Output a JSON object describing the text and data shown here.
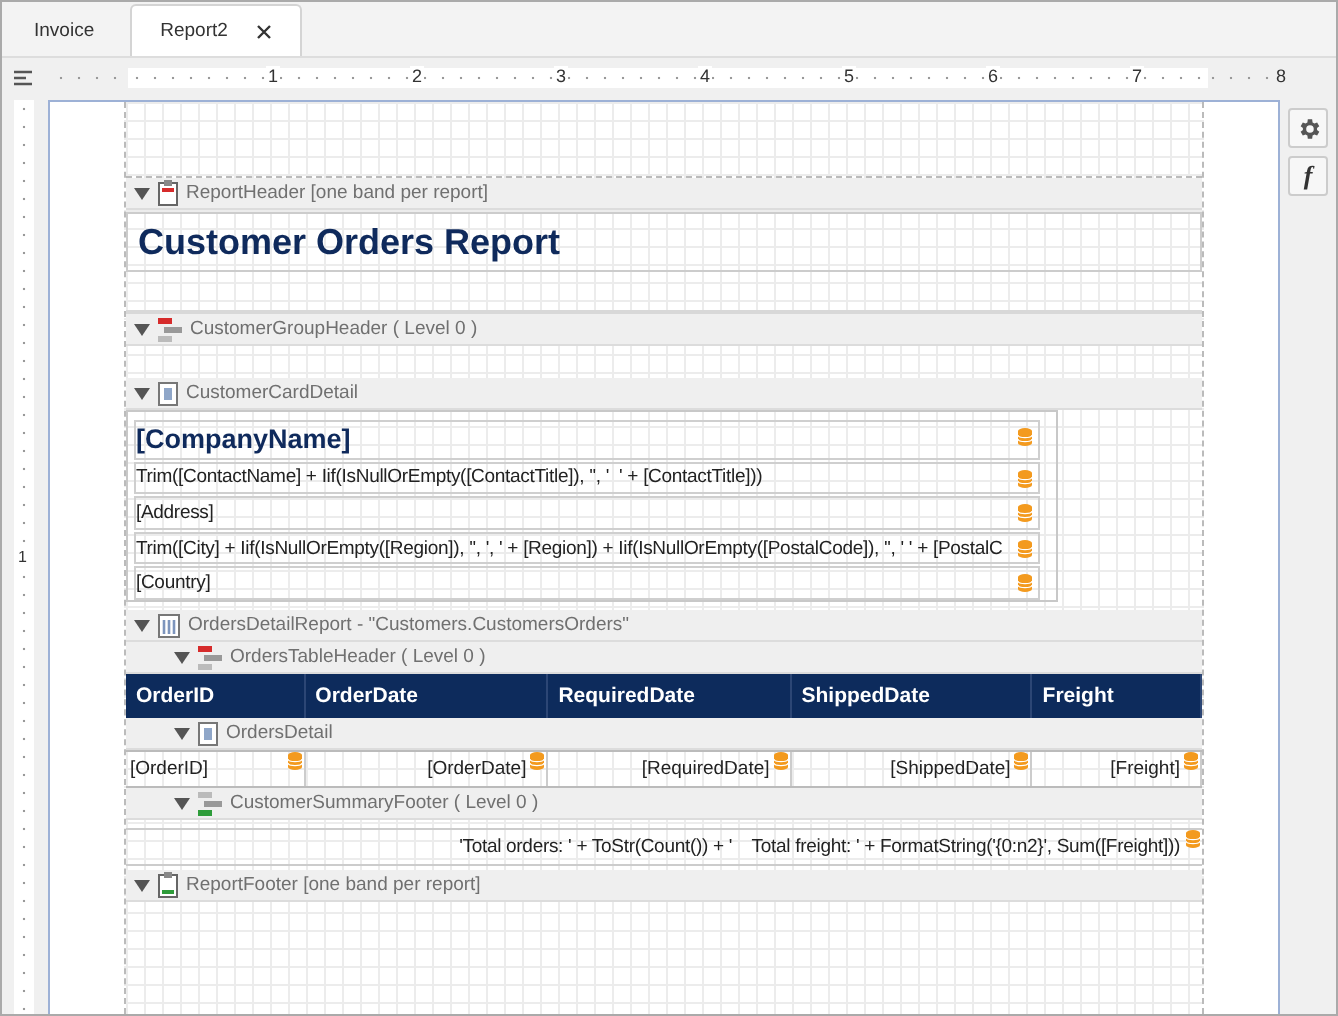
{
  "tabs": [
    {
      "label": "Invoice",
      "selected": false
    },
    {
      "label": "Report2",
      "selected": true
    }
  ],
  "ruler": {
    "marks": [
      "1",
      "2",
      "3",
      "4",
      "5",
      "6",
      "7",
      "8"
    ],
    "vertical_marks": [
      "1"
    ]
  },
  "side_buttons": [
    {
      "kind": "settings"
    },
    {
      "kind": "function",
      "glyph": "f"
    }
  ],
  "sections": [
    {
      "label": "ReportHeader [one band per report]",
      "kind": "report-header",
      "expanded": true,
      "content": {
        "kind": "title",
        "text": "Customer Orders Report"
      }
    },
    {
      "label": "CustomerGroupHeader ( Level 0 )",
      "kind": "group-header",
      "expanded": true
    },
    {
      "label": "CustomerCardDetail",
      "kind": "detail",
      "expanded": true,
      "content": {
        "kind": "card",
        "fields": [
          {
            "kind": "heading",
            "text": "[CompanyName]"
          },
          {
            "kind": "plain",
            "text": "Trim([ContactName] + Iif(IsNullOrEmpty([ContactTitle]), '', '  ' + [ContactTitle]))"
          },
          {
            "kind": "plain",
            "text": "[Address]"
          },
          {
            "kind": "plain",
            "text": "Trim([City] + Iif(IsNullOrEmpty([Region]), '', ', ' + [Region]) + Iif(IsNullOrEmpty([PostalCode]), '', ' ' + [PostalC"
          },
          {
            "kind": "plain",
            "text": "[Country]"
          }
        ]
      }
    },
    {
      "label": "OrdersDetailReport - \"Customers.CustomersOrders\"",
      "kind": "detail-report",
      "expanded": true,
      "children": [
        {
          "label": "OrdersTableHeader ( Level 0 )",
          "kind": "group-header",
          "expanded": true,
          "content": {
            "kind": "table_header",
            "columns": [
              "OrderID",
              "OrderDate",
              "RequiredDate",
              "ShippedDate",
              "Freight"
            ]
          }
        },
        {
          "label": "OrdersDetail",
          "kind": "detail",
          "expanded": true,
          "content": {
            "kind": "table_row",
            "cells": [
              "[OrderID]",
              "[OrderDate]",
              "[RequiredDate]",
              "[ShippedDate]",
              "[Freight]"
            ]
          }
        },
        {
          "label": "CustomerSummaryFooter ( Level 0 )",
          "kind": "group-footer",
          "expanded": true,
          "content": {
            "kind": "summary",
            "text": "'Total orders: ' + ToStr(Count()) + '    Total freight: ' + FormatString('{0:n2}', Sum([Freight]))"
          }
        }
      ]
    },
    {
      "label": "ReportFooter [one band per report]",
      "kind": "report-footer",
      "expanded": true
    }
  ]
}
